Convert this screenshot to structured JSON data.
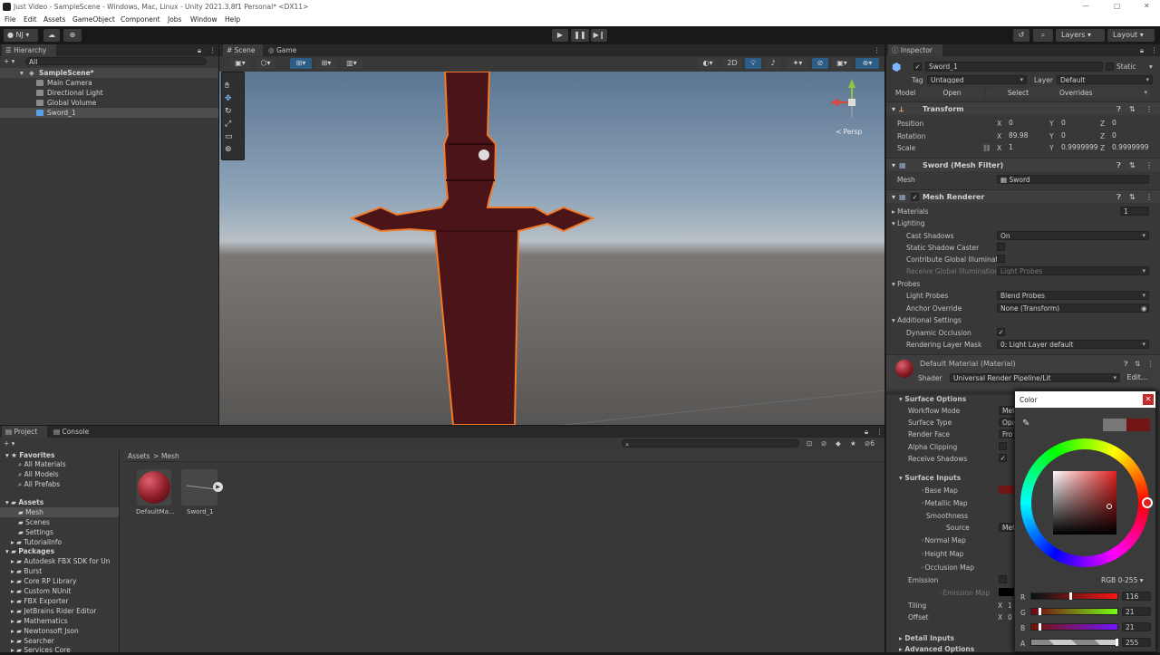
{
  "window": {
    "title": "Just Video - SampleScene - Windows, Mac, Linux - Unity 2021.3.8f1 Personal* <DX11>"
  },
  "menu": [
    "File",
    "Edit",
    "Assets",
    "GameObject",
    "Component",
    "Jobs",
    "Window",
    "Help"
  ],
  "toolbar": {
    "account": "NJ",
    "layers": "Layers",
    "layout": "Layout"
  },
  "hierarchy": {
    "tab": "Hierarchy",
    "search": "All",
    "scene": "SampleScene*",
    "items": [
      "Main Camera",
      "Directional Light",
      "Global Volume",
      "Sword_1"
    ]
  },
  "scene": {
    "tabs": [
      "Scene",
      "Game"
    ],
    "mode_2d": "2D",
    "persp": "< Persp"
  },
  "project": {
    "tabs": [
      "Project",
      "Console"
    ],
    "favorites_title": "Favorites",
    "favorites": [
      "All Materials",
      "All Models",
      "All Prefabs"
    ],
    "assets_title": "Assets",
    "assets": [
      "Mesh",
      "Scenes",
      "Settings",
      "TutorialInfo"
    ],
    "packages_title": "Packages",
    "packages": [
      "Autodesk FBX SDK for Un",
      "Burst",
      "Core RP Library",
      "Custom NUnit",
      "FBX Exporter",
      "JetBrains Rider Editor",
      "Mathematics",
      "Newtonsoft Json",
      "Searcher",
      "Services Core"
    ],
    "breadcrumb": [
      "Assets",
      "Mesh"
    ],
    "files": [
      "DefaultMa...",
      "Sword_1"
    ],
    "count": "6"
  },
  "inspector": {
    "tab": "Inspector",
    "name": "Sword_1",
    "static": "Static",
    "tag_label": "Tag",
    "tag": "Untagged",
    "layer_label": "Layer",
    "layer": "Default",
    "model_label": "Model",
    "model_buttons": [
      "Open",
      "Select",
      "Overrides"
    ],
    "transform": {
      "title": "Transform",
      "rows": [
        {
          "label": "Position",
          "x": "0",
          "y": "0",
          "z": "0"
        },
        {
          "label": "Rotation",
          "x": "89.98",
          "y": "0",
          "z": "0"
        },
        {
          "label": "Scale",
          "x": "1",
          "y": "0.9999999",
          "z": "0.9999999"
        }
      ]
    },
    "mesh_filter": {
      "title": "Sword (Mesh Filter)",
      "mesh_label": "Mesh",
      "mesh": "Sword"
    },
    "mesh_renderer": {
      "title": "Mesh Renderer",
      "materials": "Materials",
      "materials_count": "1",
      "lighting": "Lighting",
      "cast_shadows_label": "Cast Shadows",
      "cast_shadows": "On",
      "static_caster": "Static Shadow Caster",
      "contribute_gi": "Contribute Global Illuminat",
      "receive_gi": "Receive Global Illumination",
      "receive_gi_value": "Light Probes",
      "probes": "Probes",
      "light_probes_label": "Light Probes",
      "light_probes": "Blend Probes",
      "anchor_label": "Anchor Override",
      "anchor": "None (Transform)",
      "additional": "Additional Settings",
      "dynamic_occlusion": "Dynamic Occlusion",
      "render_layer_label": "Rendering Layer Mask",
      "render_layer": "0: Light Layer default"
    },
    "material": {
      "title": "Default Material (Material)",
      "shader_label": "Shader",
      "shader": "Universal Render Pipeline/Lit",
      "edit": "Edit...",
      "surface_options": "Surface Options",
      "workflow": "Workflow Mode",
      "workflow_v": "Met",
      "surface_type": "Surface Type",
      "surface_type_v": "Opa",
      "render_face": "Render Face",
      "render_face_v": "Fro",
      "alpha_clip": "Alpha Clipping",
      "receive_shadows": "Receive Shadows",
      "surface_inputs": "Surface Inputs",
      "base_map": "Base Map",
      "metallic_map": "Metallic Map",
      "smoothness": "Smoothness",
      "source": "Source",
      "source_v": "Met",
      "normal_map": "Normal Map",
      "height_map": "Height Map",
      "occlusion_map": "Occlusion Map",
      "emission": "Emission",
      "emission_map": "Emission Map",
      "tiling": "Tiling",
      "tiling_x": "X",
      "tiling_v": "1",
      "offset": "Offset",
      "offset_x": "X",
      "offset_v": "0",
      "detail_inputs": "Detail Inputs",
      "advanced": "Advanced Options"
    }
  },
  "color_picker": {
    "title": "Color",
    "mode": "RGB 0-255",
    "channels": [
      {
        "label": "R",
        "value": "116",
        "frac": 0.455
      },
      {
        "label": "G",
        "value": "21",
        "frac": 0.082
      },
      {
        "label": "B",
        "value": "21",
        "frac": 0.082
      },
      {
        "label": "A",
        "value": "255",
        "frac": 1.0
      }
    ],
    "current_color": "#741515"
  },
  "colors": {
    "accent": "#3a72b0",
    "selection": "#2c5d87",
    "sword": "#4a1418",
    "outline": "#f07a2a"
  }
}
